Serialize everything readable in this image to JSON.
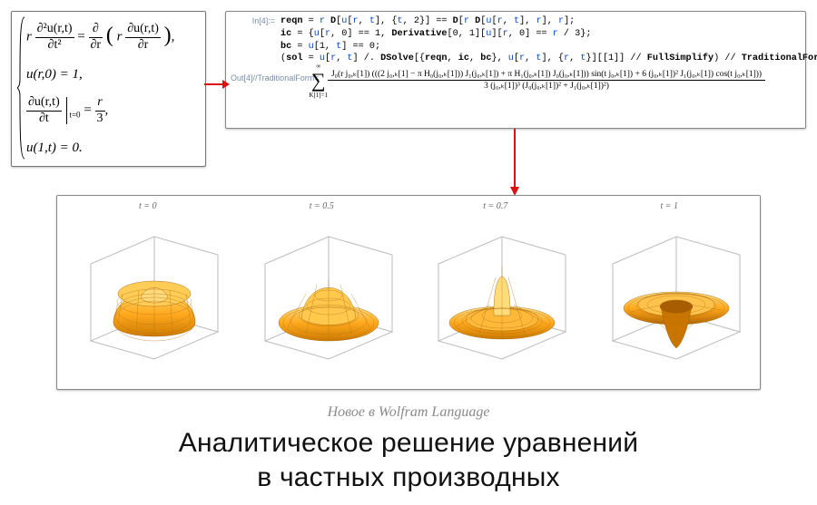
{
  "subtitle": "Новое в Wolfram Language",
  "title_line1": "Аналитическое решение уравнений",
  "title_line2": "в частных производных",
  "math": {
    "eq1_left_num": "∂²u(r,t)",
    "eq1_left_den": "∂t²",
    "eq1_right_outer_num": "∂",
    "eq1_right_outer_den": "∂r",
    "eq1_right_inner_num": "∂u(r,t)",
    "eq1_right_inner_den": "∂r",
    "eq2": "u(r,0) = 1,",
    "eq3_left_num": "∂u(r,t)",
    "eq3_left_den": "∂t",
    "eq3_sub": "t=0",
    "eq3_right_num": "r",
    "eq3_right_den": "3",
    "eq4": "u(1,t) = 0."
  },
  "code": {
    "in_label": "In[4]:=",
    "out_label": "Out[4]//TraditionalForm=",
    "l1a": "reqn",
    "l1b": " = ",
    "l1c": "r",
    "l1d": " D",
    "l1e": "[",
    "l1f": "u",
    "l1g": "[",
    "l1h": "r",
    "l1i": ", ",
    "l1j": "t",
    "l1k": "], {",
    "l1l": "t",
    "l1m": ", 2}] == ",
    "l1n": "D",
    "l1o": "[",
    "l1p": "r",
    "l1q": " D",
    "l1r": "[",
    "l1s": "u",
    "l1t": "[",
    "l1u": "r",
    "l1v": ", ",
    "l1w": "t",
    "l1x": "], ",
    "l1y": "r",
    "l1z": "], ",
    "l1za": "r",
    "l1zb": "];",
    "l2a": "ic",
    "l2b": " = {",
    "l2c": "u",
    "l2d": "[",
    "l2e": "r",
    "l2f": ", 0] == 1, ",
    "l2g": "Derivative",
    "l2h": "[0, 1][",
    "l2i": "u",
    "l2j": "][",
    "l2k": "r",
    "l2l": ", 0] == ",
    "l2m": "r",
    "l2n": " / 3};",
    "l3a": "bc",
    "l3b": " = ",
    "l3c": "u",
    "l3d": "[1, ",
    "l3e": "t",
    "l3f": "] == 0;",
    "l4a": "(",
    "l4b": "sol",
    "l4c": " = ",
    "l4d": "u",
    "l4e": "[",
    "l4f": "r",
    "l4g": ", ",
    "l4h": "t",
    "l4i": "] /. ",
    "l4j": "DSolve",
    "l4k": "[{",
    "l4l": "reqn",
    "l4m": ", ",
    "l4n": "ic",
    "l4o": ", ",
    "l4p": "bc",
    "l4q": "}, ",
    "l4r": "u",
    "l4s": "[",
    "l4t": "r",
    "l4u": ", ",
    "l4v": "t",
    "l4w": "], {",
    "l4x": "r",
    "l4y": ", ",
    "l4z": "t",
    "l4za": "}][[1]] // ",
    "l4zb": "FullSimplify",
    "l4zc": ") // ",
    "l4zd": "TraditionalForm",
    "out_num": "J₀(r j₀,ₖ[1]) (((2 j₀,ₖ[1] − π H₀(j₀,ₖ[1])) J₁(j₀,ₖ[1]) + π H₁(j₀,ₖ[1]) J₀(j₀,ₖ[1])) sin(t j₀,ₖ[1]) + 6 (j₀,ₖ[1])² J₁(j₀,ₖ[1]) cos(t j₀,ₖ[1]))",
    "out_den": "3 (j₀,ₖ[1])³ (J₀(j₀,ₖ[1])² + J₁(j₀,ₖ[1])²)",
    "sum_top": "∞",
    "sum_bot": "K[1]=1"
  },
  "plots": {
    "labels": [
      "t = 0",
      "t = 0.5",
      "t = 0.7",
      "t = 1"
    ]
  }
}
